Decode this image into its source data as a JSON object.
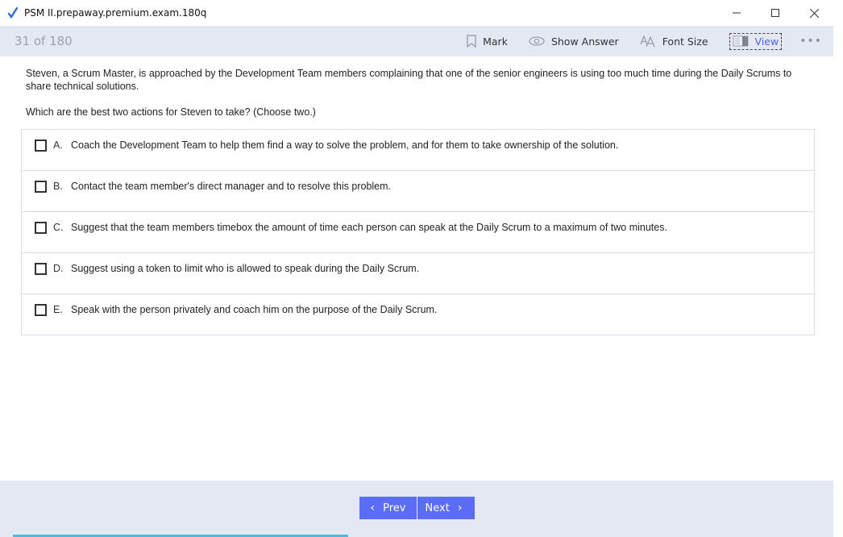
{
  "window": {
    "title": "PSM II.prepaway.premium.exam.180q",
    "controls": {
      "minimize": "—",
      "maximize": "☐",
      "close": "✕"
    }
  },
  "toolbar": {
    "counter": "31 of 180",
    "mark_label": "Mark",
    "show_answer_label": "Show Answer",
    "font_size_label": "Font Size",
    "view_label": "View",
    "more_label": "•••"
  },
  "question": {
    "text": "Steven, a Scrum Master, is approached by the Development Team members complaining that one of the senior engineers is using too much time during the Daily Scrums to share technical solutions.",
    "instruction": "Which are the best two actions for Steven to take? (Choose two.)",
    "options": [
      {
        "letter": "A.",
        "text": "Coach the Development Team to help them find a way to solve the problem, and for them to take ownership of the solution.",
        "checked": false
      },
      {
        "letter": "B.",
        "text": "Contact the team member's direct manager and to resolve this problem.",
        "checked": false
      },
      {
        "letter": "C.",
        "text": "Suggest that the team members timebox the amount of time each person can speak at the Daily Scrum to a maximum of two minutes.",
        "checked": false
      },
      {
        "letter": "D.",
        "text": "Suggest using a token to limit who is allowed to speak during the Daily Scrum.",
        "checked": false
      },
      {
        "letter": "E.",
        "text": "Speak with the person privately and coach him on the purpose of the Daily Scrum.",
        "checked": false
      }
    ]
  },
  "navigation": {
    "prev_label": "Prev",
    "next_label": "Next"
  },
  "colors": {
    "accent": "#5b6cf7",
    "toolbar_bg": "#e4e8f3",
    "view_active": "#4a63e6"
  }
}
